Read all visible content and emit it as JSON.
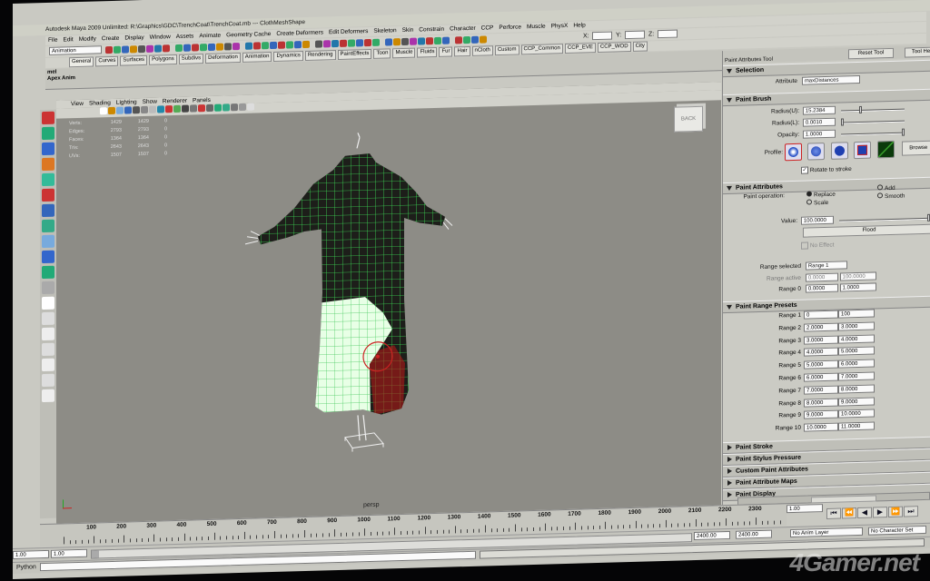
{
  "window": {
    "title": "Autodesk Maya 2009 Unlimited: R:\\Graphics\\GDC\\TrenchCoat\\TrenchCoat.mb  ---  ClothMeshShape"
  },
  "menubar": [
    "File",
    "Edit",
    "Modify",
    "Create",
    "Display",
    "Window",
    "Assets",
    "Animate",
    "Geometry Cache",
    "Create Deformers",
    "Edit Deformers",
    "Skeleton",
    "Skin",
    "Constrain",
    "Character",
    "CCP",
    "Perforce",
    "Muscle",
    "PhysX",
    "Help"
  ],
  "status_line": {
    "mode": "Animation",
    "coords": [
      "X:",
      "Y:",
      "Z:"
    ]
  },
  "shelf_tabs": [
    "General",
    "Curves",
    "Surfaces",
    "Polygons",
    "Subdivs",
    "Deformation",
    "Animation",
    "Dynamics",
    "Rendering",
    "PaintEffects",
    "Toon",
    "Muscle",
    "Fluids",
    "Fur",
    "Hair",
    "nCloth",
    "Custom",
    "CCP_Common",
    "CCP_EVE",
    "CCP_WOD",
    "City"
  ],
  "shelf_left": [
    "mel",
    "Apex",
    "Anim"
  ],
  "viewport": {
    "menu": [
      "View",
      "Shading",
      "Lighting",
      "Show",
      "Renderer",
      "Panels"
    ],
    "hud": [
      {
        "label": "Verts:",
        "a": "1429",
        "b": "1429",
        "c": "0"
      },
      {
        "label": "Edges:",
        "a": "2793",
        "b": "2793",
        "c": "0"
      },
      {
        "label": "Faces:",
        "a": "1364",
        "b": "1364",
        "c": "0"
      },
      {
        "label": "Tris:",
        "a": "2643",
        "b": "2643",
        "c": "0"
      },
      {
        "label": "UVs:",
        "a": "1507",
        "b": "1507",
        "c": "0"
      }
    ],
    "camera": "persp",
    "viewcube": "BACK"
  },
  "tool_panel": {
    "title": "Paint Attributes Tool",
    "reset": "Reset Tool",
    "help": "Tool He",
    "selection": {
      "header": "Selection",
      "attr_label": "Attribute",
      "attr_value": "maxDistances"
    },
    "brush": {
      "header": "Paint Brush",
      "radius_u_label": "Radius(U):",
      "radius_u": "15.2384",
      "radius_u_frac": 0.3,
      "radius_l_label": "Radius(L):",
      "radius_l": "0.0010",
      "radius_l_frac": 0.0,
      "opacity_label": "Opacity:",
      "opacity": "1.0000",
      "opacity_frac": 1.0,
      "profile_label": "Profile:",
      "browse": "Browse",
      "rotate": "Rotate to stroke"
    },
    "attrs": {
      "header": "Paint Attributes",
      "op_label": "Paint operation:",
      "ops": [
        "Replace",
        "Add",
        "Scale",
        "Smooth"
      ],
      "value_label": "Value:",
      "value": "100.0000",
      "value_frac": 1.0,
      "flood": "Flood",
      "no_effect": "No Effect",
      "range_sel_label": "Range selected",
      "range_sel": "Range 1",
      "range_active_label": "Range active",
      "range_active_a": "0.0000",
      "range_active_b": "100.0000",
      "range0_label": "Range 0",
      "range0_a": "0.0000",
      "range0_b": "1.0000"
    },
    "presets": {
      "header": "Paint Range Presets",
      "rows": [
        {
          "label": "Range 1",
          "a": "0",
          "b": "100"
        },
        {
          "label": "Range 2",
          "a": "2.0000",
          "b": "3.0000"
        },
        {
          "label": "Range 3",
          "a": "3.0000",
          "b": "4.0000"
        },
        {
          "label": "Range 4",
          "a": "4.0000",
          "b": "5.0000"
        },
        {
          "label": "Range 5",
          "a": "5.0000",
          "b": "6.0000"
        },
        {
          "label": "Range 6",
          "a": "6.0000",
          "b": "7.0000"
        },
        {
          "label": "Range 7",
          "a": "7.0000",
          "b": "8.0000"
        },
        {
          "label": "Range 8",
          "a": "8.0000",
          "b": "9.0000"
        },
        {
          "label": "Range 9",
          "a": "9.0000",
          "b": "10.0000"
        },
        {
          "label": "Range 10",
          "a": "10.0000",
          "b": "11.0000"
        }
      ]
    },
    "collapsed": [
      "Paint Stroke",
      "Paint Stylus Pressure",
      "Custom Paint Attributes",
      "Paint Attribute Maps",
      "Paint Display"
    ]
  },
  "timeline": {
    "ticks": [
      "100",
      "200",
      "300",
      "400",
      "500",
      "600",
      "700",
      "800",
      "900",
      "1000",
      "1100",
      "1200",
      "1300",
      "1400",
      "1500",
      "1600",
      "1700",
      "1800",
      "1900",
      "2000",
      "2100",
      "2200",
      "2300"
    ],
    "current": "1.00"
  },
  "range_slider": {
    "start": "1.00",
    "inner_start": "1.00",
    "inner_end": "2400.00",
    "end": "2400.00",
    "anim_layer": "No Anim Layer",
    "char_set": "No Character Set"
  },
  "command_line": {
    "label": "Python"
  },
  "watermark": "4Gamer.net",
  "colors": {
    "ui_bg": "#c9c9c2",
    "viewport_bg": "#8d8c86",
    "mesh_dark": "#1d1e1a",
    "mesh_wire": "#3ddc55",
    "mesh_paint": "#e8ffe6"
  }
}
